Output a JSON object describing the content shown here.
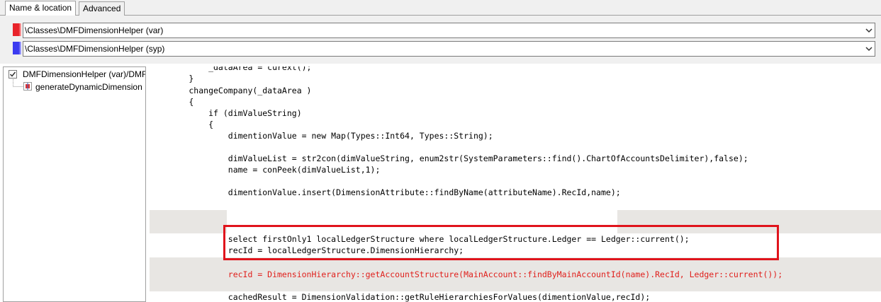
{
  "tabs": [
    {
      "label": "Name & location",
      "active": true
    },
    {
      "label": "Advanced",
      "active": false
    }
  ],
  "selectors": [
    {
      "value": "\\Classes\\DMFDimensionHelper (var)",
      "color": "#e8232a"
    },
    {
      "value": "\\Classes\\DMFDimensionHelper (syp)",
      "color": "#3b3bf0"
    }
  ],
  "tree": {
    "root_label": "DMFDimensionHelper (var)/DMF",
    "child_label": "generateDynamicDimension"
  },
  "code": {
    "lines": [
      "            _dataArea = curext();",
      "        }",
      "        changeCompany(_dataArea )",
      "        {",
      "            if (dimValueString)",
      "            {",
      "                dimentionValue = new Map(Types::Int64, Types::String);",
      "",
      "                dimValueList = str2con(dimValueString, enum2str(SystemParameters::find().ChartOfAccountsDelimiter),false);",
      "                name = conPeek(dimValueList,1);",
      "",
      "                dimentionValue.insert(DimensionAttribute::findByName(attributeName).RecId,name);",
      "",
      "",
      "",
      "                select firstOnly1 localLedgerStructure where localLedgerStructure.Ledger == Ledger::current();",
      "                recId = localLedgerStructure.DimensionHierarchy;",
      "",
      "                recId = DimensionHierarchy::getAccountStructure(MainAccount::findByMainAccountId(name).RecId, Ledger::current());",
      "",
      "                cachedResult = DimensionValidation::getRuleHierarchiesForValues(dimentionValue,recId);"
    ],
    "changed_line_color": "#e0201c",
    "highlight_color": "#e8e6e3",
    "annotation_color": "#e0141c"
  }
}
